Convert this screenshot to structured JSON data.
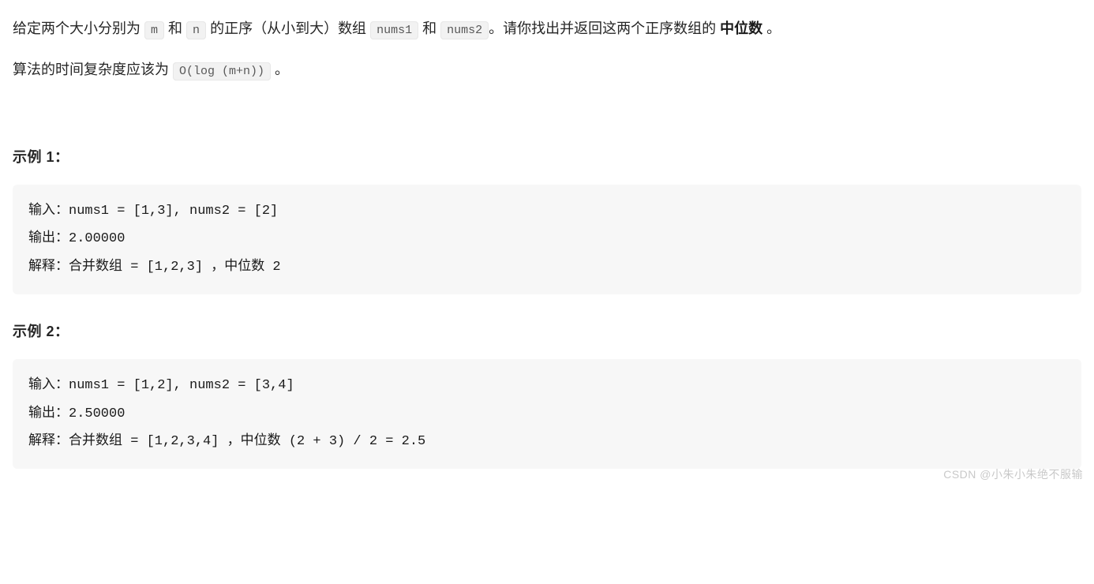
{
  "problem": {
    "p1_part1": "给定两个大小分别为 ",
    "p1_code1": "m",
    "p1_part2": " 和 ",
    "p1_code2": "n",
    "p1_part3": " 的正序（从小到大）数组 ",
    "p1_code3": "nums1",
    "p1_part4": " 和 ",
    "p1_code4": "nums2",
    "p1_part5": "。请你找出并返回这两个正序数组的 ",
    "p1_bold": "中位数",
    "p1_part6": " 。",
    "p2_part1": "算法的时间复杂度应该为 ",
    "p2_code1": "O(log (m+n))",
    "p2_part2": " 。"
  },
  "examples": [
    {
      "title": "示例 1：",
      "text": "输入：nums1 = [1,3], nums2 = [2]\n输出：2.00000\n解释：合并数组 = [1,2,3] ，中位数 2"
    },
    {
      "title": "示例 2：",
      "text": "输入：nums1 = [1,2], nums2 = [3,4]\n输出：2.50000\n解释：合并数组 = [1,2,3,4] ，中位数 (2 + 3) / 2 = 2.5"
    }
  ],
  "watermark": "CSDN @小朱小朱绝不服输"
}
